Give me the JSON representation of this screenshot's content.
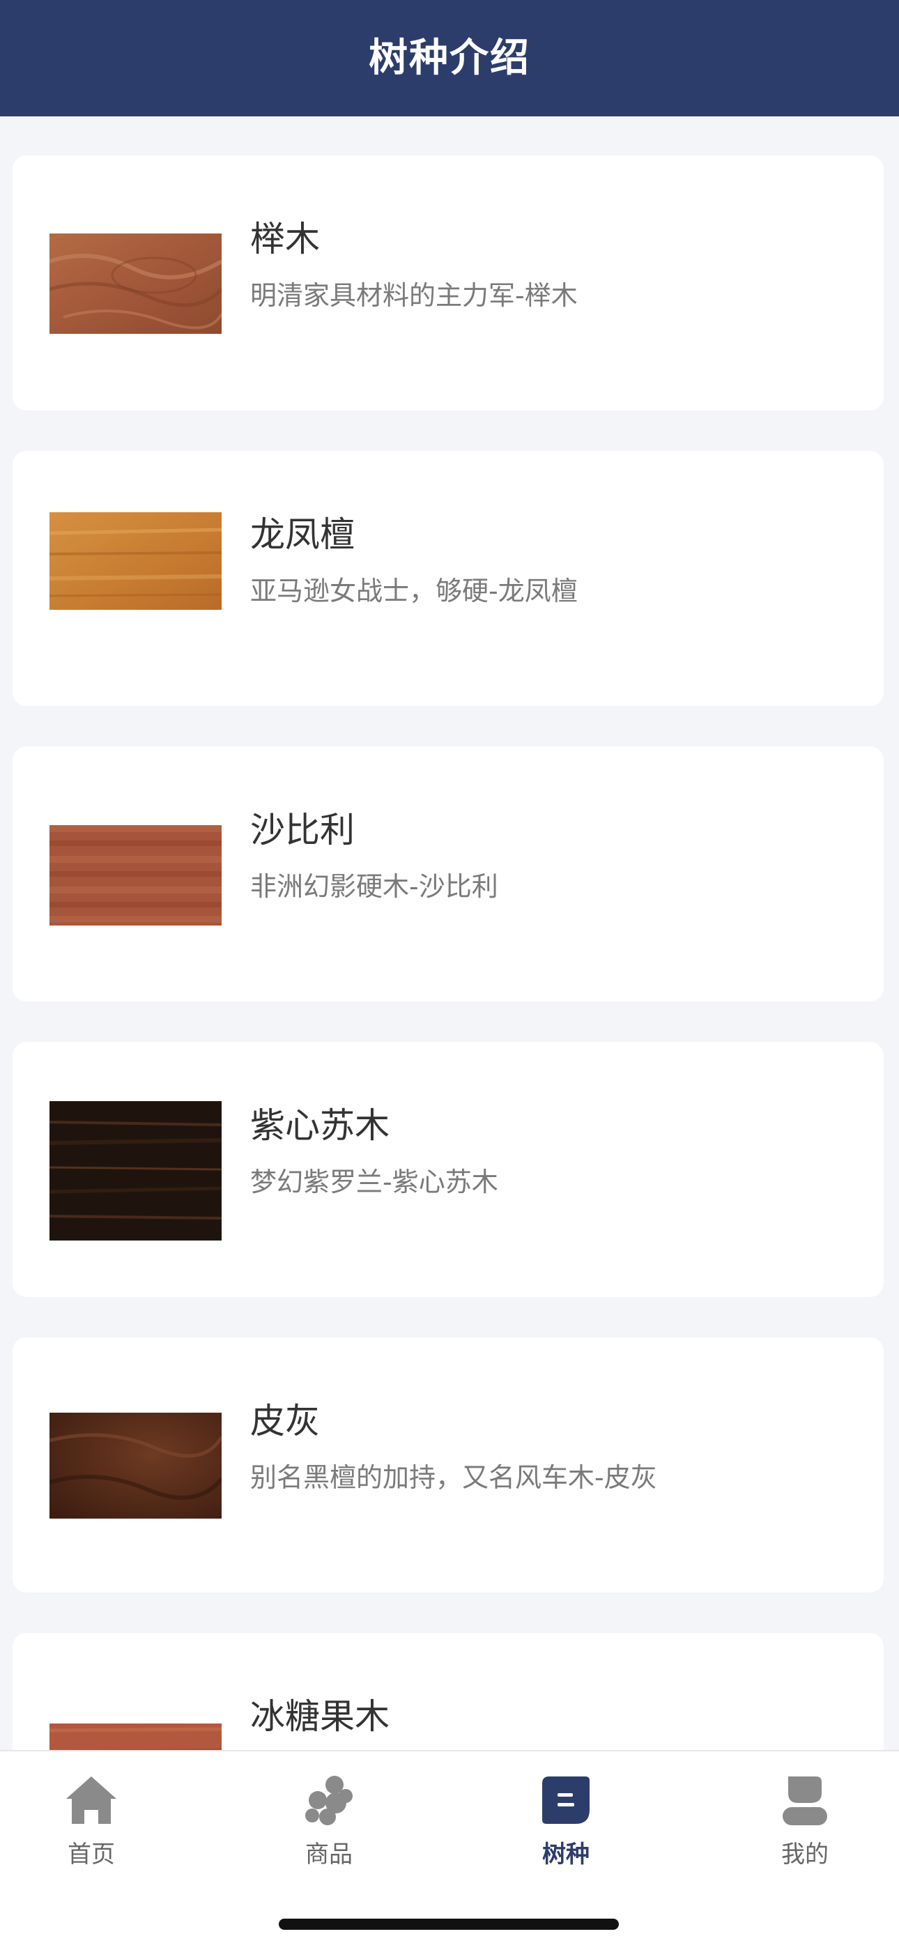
{
  "header": {
    "title": "树种介绍"
  },
  "woods": [
    {
      "name": "榉木",
      "desc": "明清家具材料的主力军-榉木",
      "icon": "beech-wood-swatch"
    },
    {
      "name": "龙凤檀",
      "desc": "亚马逊女战士，够硬-龙凤檀",
      "icon": "tigerwood-swatch"
    },
    {
      "name": "沙比利",
      "desc": "非洲幻影硬木-沙比利",
      "icon": "sapele-swatch"
    },
    {
      "name": "紫心苏木",
      "desc": "梦幻紫罗兰-紫心苏木",
      "icon": "purpleheart-swatch"
    },
    {
      "name": "皮灰",
      "desc": "别名黑檀的加持，又名风车木-皮灰",
      "icon": "pihui-swatch"
    },
    {
      "name": "冰糖果木",
      "desc": "",
      "icon": "bingtangguo-swatch"
    }
  ],
  "tabs": [
    {
      "label": "首页",
      "icon": "home-icon",
      "active": false
    },
    {
      "label": "商品",
      "icon": "products-icon",
      "active": false
    },
    {
      "label": "树种",
      "icon": "wood-species-icon",
      "active": true
    },
    {
      "label": "我的",
      "icon": "profile-icon",
      "active": false
    }
  ],
  "colors": {
    "brand": "#2c3d6b",
    "background": "#f4f5f9",
    "tab_inactive": "#8a8a8a"
  }
}
